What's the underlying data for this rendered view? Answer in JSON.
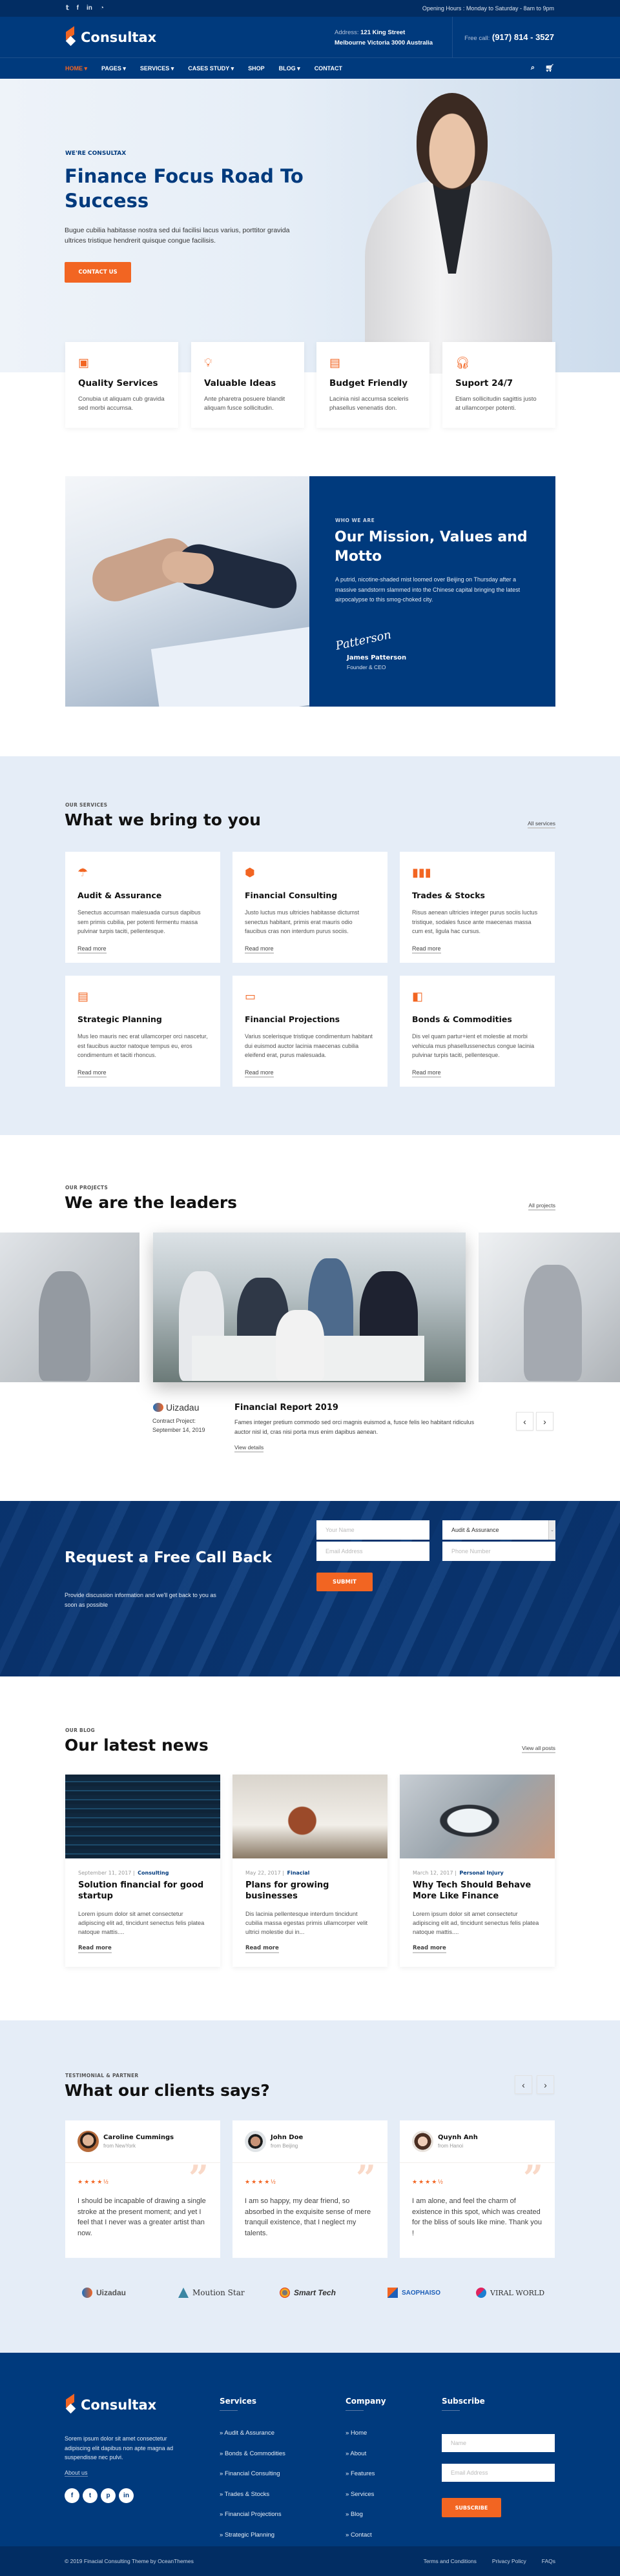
{
  "colors": {
    "navy": "#003a7d",
    "dark_navy": "#022d63",
    "accent": "#f26522",
    "light_bg": "#e5edf7"
  },
  "topbar": {
    "social_icons": [
      "twitter-icon",
      "facebook-icon",
      "linkedin-icon",
      "rss-icon"
    ],
    "hours": "Opening Hours : Monday to Saturday - 8am to 9pm"
  },
  "header": {
    "brand": "Consultax",
    "address_label": "Address:",
    "address_line1": "121 King Street",
    "address_line2": "Melbourne Victoria 3000 Australia",
    "call_label": "Free call:",
    "phone": "(917) 814 - 3527"
  },
  "nav": {
    "items": [
      {
        "label": "HOME ▾"
      },
      {
        "label": "PAGES ▾"
      },
      {
        "label": "SERVICES ▾"
      },
      {
        "label": "CASES STUDY ▾"
      },
      {
        "label": "SHOP"
      },
      {
        "label": "BLOG ▾"
      },
      {
        "label": "CONTACT"
      }
    ],
    "search_icon": "search-icon",
    "cart_icon": "cart-icon"
  },
  "hero": {
    "kicker": "WE'RE CONSULTAX",
    "title": "Finance Focus Road To Success",
    "text": "Bugue cubilia habitasse nostra sed dui facilisi lacus varius, porttitor gravida ultrices tristique hendrerit quisque congue facilisis.",
    "cta": "CONTACT US"
  },
  "features": [
    {
      "icon": "award-icon",
      "title": "Quality Services",
      "text": "Conubia ut aliquam cub gravida sed morbi accumsa."
    },
    {
      "icon": "lightbulb-icon",
      "title": "Valuable Ideas",
      "text": "Ante pharetra posuere blandit aliquam fusce sollicitudin."
    },
    {
      "icon": "money-icon",
      "title": "Budget Friendly",
      "text": "Lacinia nisl accumsa sceleris phasellus venenatis don."
    },
    {
      "icon": "headphones-icon",
      "title": "Suport 24/7",
      "text": "Etiam sollicitudin sagittis justo at ullamcorper potenti."
    }
  ],
  "mission": {
    "kicker": "WHO WE ARE",
    "title": "Our Mission, Values and Motto",
    "text": "A putrid, nicotine-shaded mist loomed over Beijing on Thursday after a massive sandstorm slammed into the Chinese capital bringing the latest airpocalypse to this smog-choked city.",
    "signature": "Patterson",
    "name": "James Patterson",
    "role": "Founder & CEO"
  },
  "services": {
    "kicker": "OUR SERVICES",
    "title": "What we bring to you",
    "all_link": "All services",
    "read_more": "Read more",
    "items": [
      {
        "icon": "umbrella-icon",
        "title": "Audit & Assurance",
        "text": "Senectus accumsan malesuada cursus dapibus sem primis cubilia, per potenti fermentu massa pulvinar turpis taciti, pellentesque."
      },
      {
        "icon": "cube-icon",
        "title": "Financial Consulting",
        "text": "Justo luctus mus ultricies habitasse dictumst senectus habitant, primis erat mauris odio faucibus cras non interdum purus sociis."
      },
      {
        "icon": "bar-chart-icon",
        "title": "Trades & Stocks",
        "text": "Risus aenean ultricies integer purus sociis luctus tristique, sodales fusce ante maecenas massa cum est, ligula hac cursus."
      },
      {
        "icon": "document-icon",
        "title": "Strategic Planning",
        "text": "Mus leo mauris nec erat ullamcorper orci nascetur, est faucibus auctor natoque tempus eu, eros condimentum et taciti rhoncus."
      },
      {
        "icon": "banknote-icon",
        "title": "Financial Projections",
        "text": "Varius scelerisque tristique condimentum habitant dui euismod auctor lacinia maecenas cubilia eleifend erat, purus malesuada."
      },
      {
        "icon": "wallet-icon",
        "title": "Bonds & Commodities",
        "text": "Dis vel quam partur+ient et molestie at morbi vehicula mus phasellussenectus congue lacinia pulvinar turpis taciti, pellentesque."
      }
    ]
  },
  "projects": {
    "kicker": "OUR PROJECTS",
    "title": "We are the leaders",
    "all_link": "All projects",
    "client_logo": "Uizadau",
    "contract_label": "Contract Project:",
    "contract_date": "September 14, 2019",
    "item_title": "Financial Report 2019",
    "item_text": "Fames integer pretium commodo sed orci magnis euismod a, fusce felis leo habitant ridiculus auctor nisl id, cras nisi porta mus enim dapibus aenean.",
    "details_link": "View details",
    "prev": "‹",
    "next": "›"
  },
  "callback": {
    "title": "Request a Free Call Back",
    "text": "Provide discussion information and we'll get back to you as soon as possible",
    "name_placeholder": "Your Name",
    "service_selected": "Audit & Assurance",
    "email_placeholder": "Email Address",
    "phone_placeholder": "Phone Number",
    "submit": "SUBMIT"
  },
  "blog": {
    "kicker": "OUR BLOG",
    "title": "Our latest news",
    "all_link": "View all posts",
    "read_more": "Read more",
    "posts": [
      {
        "date": "September 11, 2017",
        "category": "Consulting",
        "title": "Solution financial for good startup",
        "excerpt": "Lorem ipsum dolor sit amet consectetur adipiscing elit ad, tincidunt senectus felis platea natoque mattis...."
      },
      {
        "date": "May 22, 2017",
        "category": "Finacial",
        "title": "Plans for growing businesses",
        "excerpt": "Dis lacinia pellentesque interdum tincidunt cubilia massa egestas primis ullamcorper velit ultrici molestie dui in..."
      },
      {
        "date": "March 12, 2017",
        "category": "Personal Injury",
        "title": "Why Tech Should Behave More Like Finance",
        "excerpt": "Lorem ipsum dolor sit amet consectetur adipiscing elit ad, tincidunt senectus felis platea natoque mattis...."
      }
    ]
  },
  "testimonials": {
    "kicker": "TESTIMONIAL & PARTNER",
    "title": "What our clients says?",
    "prev": "‹",
    "next": "›",
    "items": [
      {
        "name": "Caroline Cummings",
        "from": "from NewYork",
        "rating": 4.5,
        "stars": "★★★★½",
        "text": "I should be incapable of drawing a single stroke at the present moment; and yet I feel that I never was a greater artist than now."
      },
      {
        "name": "John Doe",
        "from": "from Beijing",
        "rating": 4.5,
        "stars": "★★★★½",
        "text": "I am so happy, my dear friend, so absorbed in the exquisite sense of mere tranquil existence, that I neglect my talents."
      },
      {
        "name": "Quynh Anh",
        "from": "from Hanoi",
        "rating": 4.5,
        "stars": "★★★★½",
        "text": "I am alone, and feel the charm of existence in this spot, which was created for the bliss of souls like mine. Thank you !"
      }
    ],
    "partners": [
      "Uizadau",
      "Moution Star",
      "Smart Tech",
      "SAOPHAISO",
      "VIRAL WORLD"
    ]
  },
  "footer": {
    "brand": "Consultax",
    "about": "Sorem ipsum dolor sit amet consectetur adipiscing elit dapibus non apte magna ad suspendisse nec pulvi.",
    "about_link": "About us",
    "social_icons": [
      "facebook-icon",
      "twitter-icon",
      "pinterest-icon",
      "linkedin-icon"
    ],
    "services_title": "Services",
    "services": [
      "Audit & Assurance",
      "Bonds & Commodities",
      "Financial Consulting",
      "Trades & Stocks",
      "Financial Projections",
      "Strategic Planning"
    ],
    "company_title": "Company",
    "company": [
      "Home",
      "About",
      "Features",
      "Services",
      "Blog",
      "Contact"
    ],
    "subscribe_title": "Subscribe",
    "name_placeholder": "Name",
    "email_placeholder": "Email Address",
    "subscribe_button": "SUBSCRIBE",
    "copyright": "© 2019 Finacial Consulting Theme by OceanThemes",
    "links": [
      "Terms and Conditions",
      "Privacy Policy",
      "FAQs"
    ]
  }
}
